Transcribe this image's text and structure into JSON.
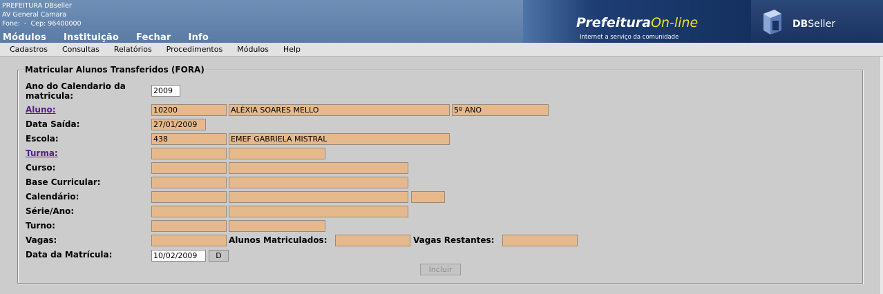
{
  "header": {
    "org_name": "PREFEITURA DBseller",
    "address": "AV General Camara",
    "phone": "Fone:  -  Cep: 96400000",
    "nav": [
      "Módulos",
      "Instituição",
      "Fechar",
      "Info"
    ],
    "logo_title_main": "Prefeitura",
    "logo_title_accent": "On-line",
    "logo_tagline": "Internet a serviço da comunidade",
    "brand_bold": "DB",
    "brand_rest": "Seller"
  },
  "menubar": [
    "Cadastros",
    "Consultas",
    "Relatórios",
    "Procedimentos",
    "Módulos",
    "Help"
  ],
  "form": {
    "legend": "Matricular Alunos Transferidos (FORA)",
    "ano_label_1": "Ano do Calendario da",
    "ano_label_2": "matricula:",
    "ano_value": "2009",
    "aluno_label": "Aluno:",
    "aluno_code": "10200",
    "aluno_name": "ALÉXIA SOARES MELLO",
    "aluno_serie": "5º ANO",
    "data_saida_label": "Data Saída:",
    "data_saida_value": "27/01/2009",
    "escola_label": "Escola:",
    "escola_code": "438",
    "escola_name": "EMEF GABRIELA MISTRAL",
    "turma_label": "Turma:",
    "curso_label": "Curso:",
    "base_label": "Base Curricular:",
    "calendario_label": "Calendário:",
    "serie_label": "Série/Ano:",
    "turno_label": "Turno:",
    "vagas_label": "Vagas:",
    "alunos_matriculados_label": "Alunos Matriculados:",
    "vagas_restantes_label": "Vagas Restantes:",
    "data_matricula_label": "Data da Matrícula:",
    "data_matricula_value": "10/02/2009",
    "date_button": "D",
    "incluir_button": "Incluir"
  }
}
